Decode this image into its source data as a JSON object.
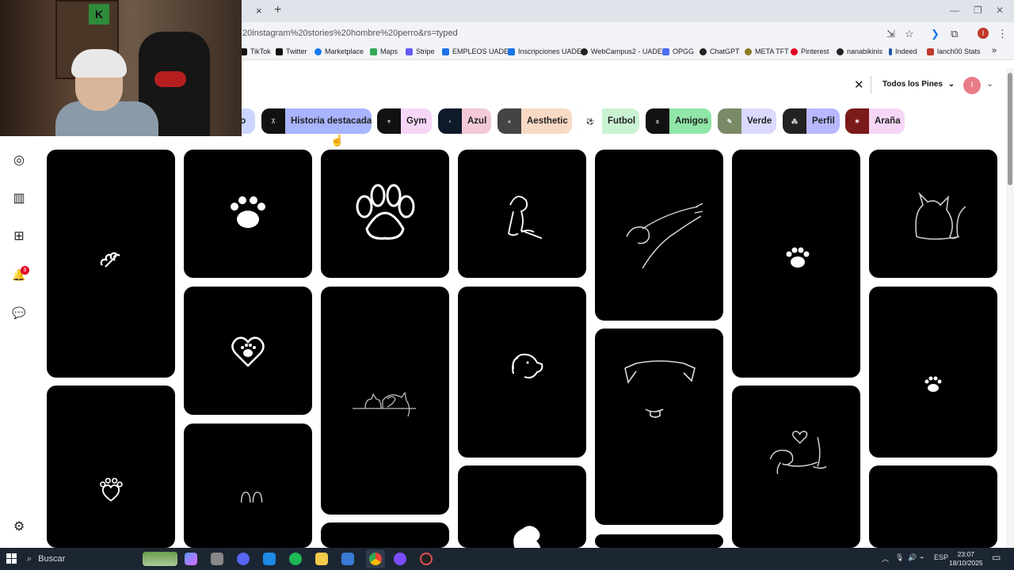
{
  "browser": {
    "url": "20instagram%20stories%20hombre%20perro&rs=typed",
    "tab_close": "×",
    "tab_new": "+",
    "bookmarks": [
      {
        "label": "TikTok",
        "color": "#111111"
      },
      {
        "label": "Twitter",
        "color": "#111111"
      },
      {
        "label": "Marketplace",
        "color": "#1877f2"
      },
      {
        "label": "Maps",
        "color": "#34a853"
      },
      {
        "label": "Stripe",
        "color": "#635bff"
      },
      {
        "label": "EMPLEOS UADE",
        "color": "#1a73e8"
      },
      {
        "label": "Inscripciones UADE",
        "color": "#1a73e8"
      },
      {
        "label": "WebCampus2 - UADE",
        "color": "#222222"
      },
      {
        "label": "OPGG",
        "color": "#4a6cf7"
      },
      {
        "label": "ChatGPT",
        "color": "#222222"
      },
      {
        "label": "META TFT",
        "color": "#8a7a1f"
      },
      {
        "label": "Pinterest",
        "color": "#e60023"
      },
      {
        "label": "nanabikinis",
        "color": "#222222"
      },
      {
        "label": "Indeed",
        "color": "#2557a7"
      },
      {
        "label": "lanch00 Stats",
        "color": "#c0392b"
      }
    ],
    "bookmarks_more": "»",
    "profile_initial": "I"
  },
  "webcam": {
    "sign_letter": "K"
  },
  "header": {
    "clear_icon": "✕",
    "filter_label": "Todos los Pines",
    "filter_chevron": "⌄",
    "avatar_initial": "I",
    "account_chevron": "⌄"
  },
  "chips": [
    {
      "label": "jo",
      "bg": "#cbd5ff",
      "thumb": false
    },
    {
      "label": "Historia destacada",
      "bg": "#a9b4ff",
      "thumb": true
    },
    {
      "label": "Gym",
      "bg": "#f6d6f7",
      "thumb": true
    },
    {
      "label": "Azul",
      "bg": "#f3c9d6",
      "thumb": true
    },
    {
      "label": "Aesthetic",
      "bg": "#f8d9c4",
      "thumb": true
    },
    {
      "label": "Futbol",
      "bg": "#c9f2d2",
      "thumb": true
    },
    {
      "label": "Amigos",
      "bg": "#8fe6a6",
      "thumb": true
    },
    {
      "label": "Verde",
      "bg": "#dcd9ff",
      "thumb": true
    },
    {
      "label": "Perfil",
      "bg": "#b8b7ff",
      "thumb": true
    },
    {
      "label": "Araña",
      "bg": "#f6d6f7",
      "thumb": true
    }
  ],
  "rail": {
    "explore_icon": "◎",
    "boards_icon": "▥",
    "create_icon": "⊞",
    "notifications_icon": "🔔",
    "notifications_badge": "8",
    "messages_icon": "💬",
    "settings_icon": "⚙"
  },
  "pins": [
    {
      "art": "bone"
    },
    {
      "art": "paw-big"
    },
    {
      "art": "paw-outline"
    },
    {
      "art": "dog-sitting"
    },
    {
      "art": "hand-dog"
    },
    {
      "art": "paw-small"
    },
    {
      "art": "dog-cat-sitting"
    },
    {
      "art": "paw-heart"
    },
    {
      "art": "dog-cat-line"
    },
    {
      "art": "dog-head"
    },
    {
      "art": "paw-tiny"
    },
    {
      "art": "heart-dog-hand"
    },
    {
      "art": "paw-sparkle"
    },
    {
      "art": "dog-face"
    },
    {
      "art": "blank"
    },
    {
      "art": "dog-silhouette"
    },
    {
      "art": "paw-tiny2"
    },
    {
      "art": "ears"
    },
    {
      "art": "blank"
    }
  ],
  "taskbar": {
    "search_label": "Buscar",
    "lang": "ESP",
    "time": "23:07",
    "date": "18/10/2025"
  }
}
